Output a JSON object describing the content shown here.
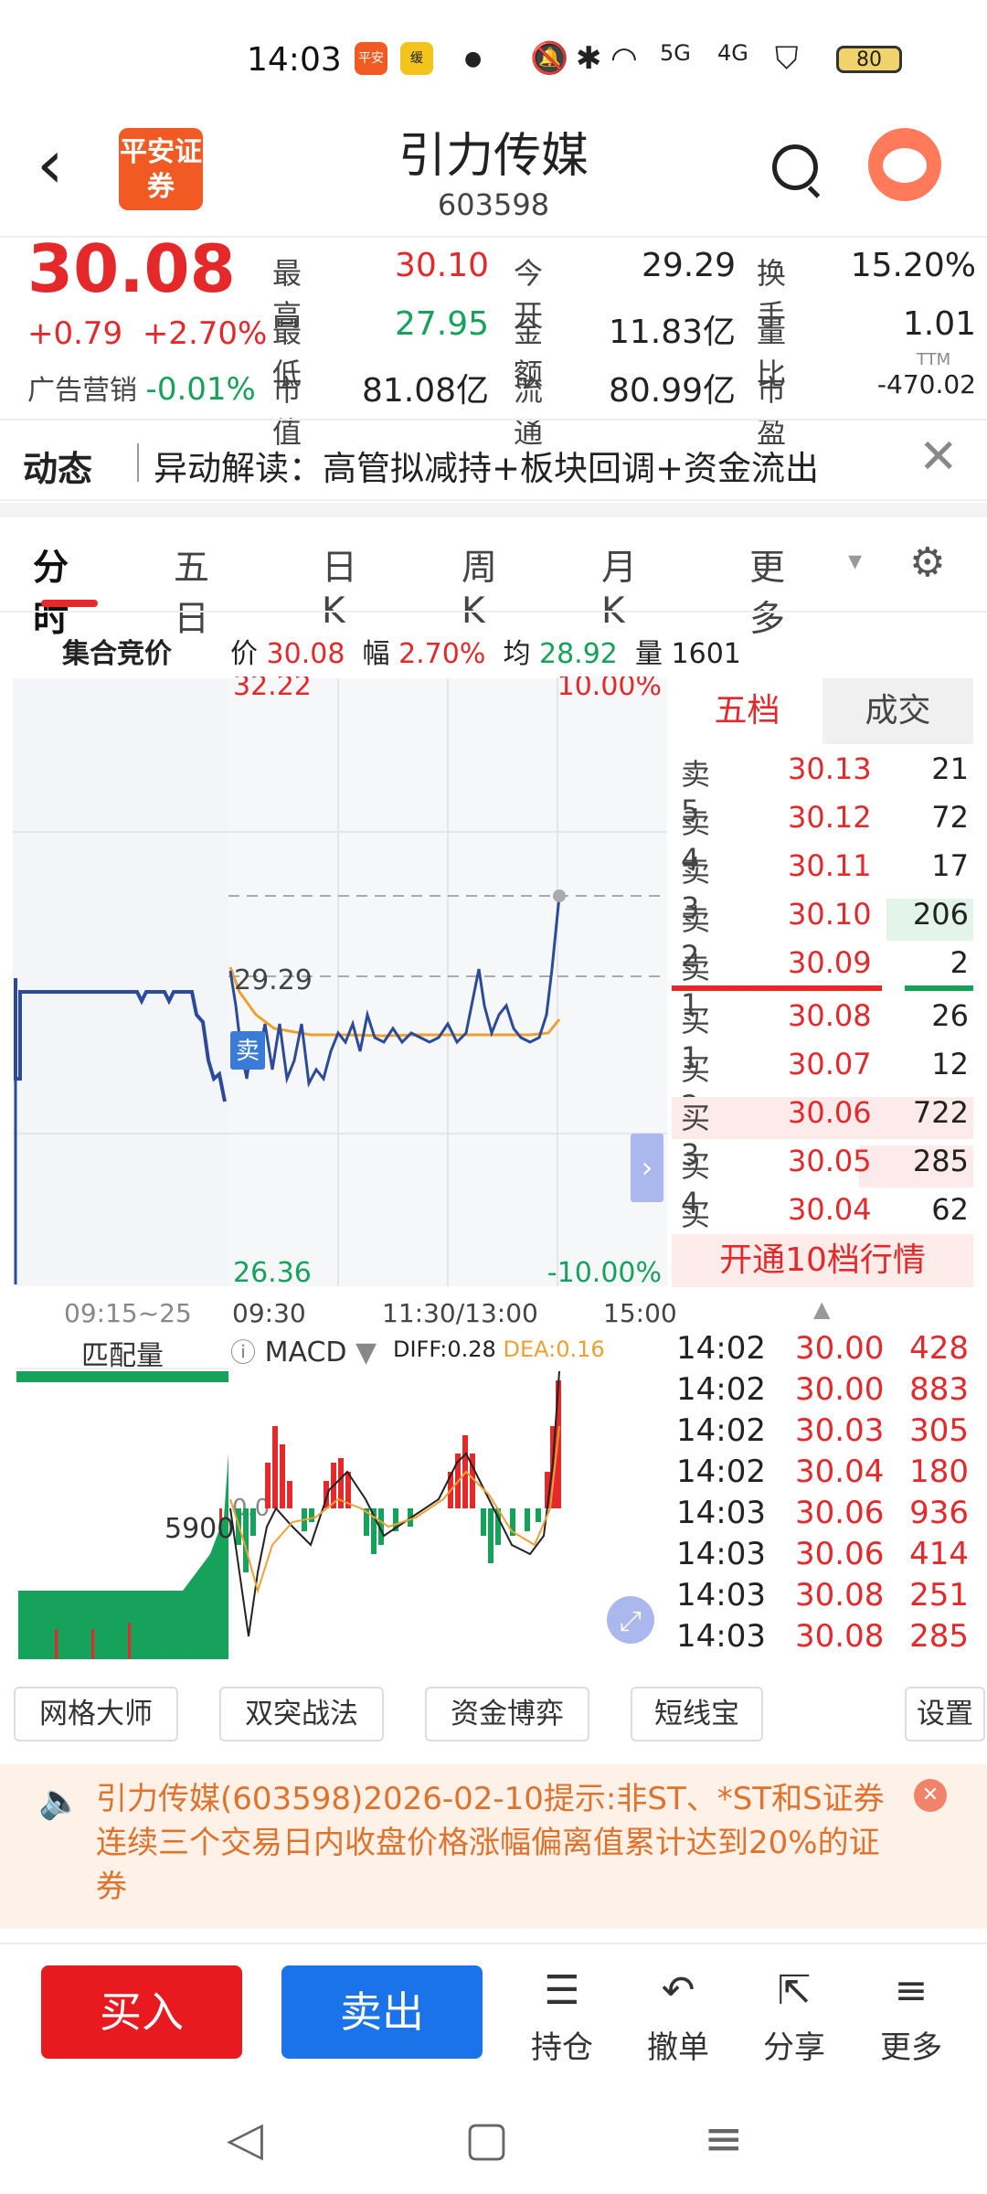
{
  "status": {
    "time": "14:03",
    "app1": "平安",
    "app2": "缓",
    "battery": "80",
    "signal1": "5G",
    "signal2": "4G"
  },
  "header": {
    "back": "‹",
    "logo": "平安证券",
    "title": "引力传媒",
    "code": "603598"
  },
  "quote": {
    "price": "30.08",
    "change": "+0.79",
    "change_pct": "+2.70%",
    "sector_label": "广告营销",
    "sector_value": "-0.01%",
    "cells": [
      {
        "label": "最高",
        "value": "30.10",
        "color": "red"
      },
      {
        "label": "今开",
        "value": "29.29",
        "color": "black"
      },
      {
        "label": "换手",
        "value": "15.20%",
        "color": "black"
      },
      {
        "label": "最低",
        "value": "27.95",
        "color": "green"
      },
      {
        "label": "金额",
        "value": "11.83亿",
        "color": "black"
      },
      {
        "label": "量比",
        "value": "1.01",
        "color": "black"
      },
      {
        "label": "市值",
        "value": "81.08亿",
        "color": "black"
      },
      {
        "label": "流通",
        "value": "80.99亿",
        "color": "black"
      },
      {
        "label": "市盈",
        "value": "-470.02",
        "color": "black"
      }
    ],
    "pe_sup": "TTM"
  },
  "news": {
    "tag": "动态",
    "text": "异动解读：高管拟减持+板块回调+资金流出",
    "close": "✕"
  },
  "tabs": [
    "分时",
    "五日",
    "日K",
    "周K",
    "月K",
    "更多"
  ],
  "tabs_more_arrow": "▾",
  "gear": "⚙",
  "minute": {
    "title": "集合竞价",
    "price_label": "价",
    "price": "30.08",
    "amp_label": "幅",
    "amp": "2.70%",
    "avg_label": "均",
    "avg": "28.92",
    "vol_label": "量",
    "vol": "1601",
    "y_top": "32.22",
    "y_bottom": "26.36",
    "pct_top": "10.00%",
    "pct_bottom": "-10.00%",
    "open_label": "29.29",
    "sell_marker": "卖",
    "x_labels": [
      "09:15~25",
      "09:30",
      "11:30/13:00",
      "15:00"
    ]
  },
  "book": {
    "tabs": [
      "五档",
      "成交"
    ],
    "asks": [
      {
        "label": "卖5",
        "price": "30.13",
        "vol": "21"
      },
      {
        "label": "卖4",
        "price": "30.12",
        "vol": "72"
      },
      {
        "label": "卖3",
        "price": "30.11",
        "vol": "17"
      },
      {
        "label": "卖2",
        "price": "30.10",
        "vol": "206"
      },
      {
        "label": "卖1",
        "price": "30.09",
        "vol": "2"
      }
    ],
    "bids": [
      {
        "label": "买1",
        "price": "30.08",
        "vol": "26"
      },
      {
        "label": "买2",
        "price": "30.07",
        "vol": "12"
      },
      {
        "label": "买3",
        "price": "30.06",
        "vol": "722"
      },
      {
        "label": "买4",
        "price": "30.05",
        "vol": "285"
      },
      {
        "label": "买5",
        "price": "30.04",
        "vol": "62"
      }
    ],
    "open10": "开通10档行情"
  },
  "ticks": [
    {
      "time": "14:02",
      "price": "30.00",
      "vol": "428"
    },
    {
      "time": "14:02",
      "price": "30.00",
      "vol": "883"
    },
    {
      "time": "14:02",
      "price": "30.03",
      "vol": "305"
    },
    {
      "time": "14:02",
      "price": "30.04",
      "vol": "180"
    },
    {
      "time": "14:03",
      "price": "30.06",
      "vol": "936"
    },
    {
      "time": "14:03",
      "price": "30.06",
      "vol": "414"
    },
    {
      "time": "14:03",
      "price": "30.08",
      "vol": "251"
    },
    {
      "time": "14:03",
      "price": "30.08",
      "vol": "285"
    }
  ],
  "macd": {
    "left_label": "匹配量",
    "indicator": "MACD",
    "diff": "DIFF:0.28",
    "dea": "DEA:0.16",
    "zero": "0.0",
    "match_level": "5900"
  },
  "tools": [
    "网格大师",
    "双突战法",
    "资金博弈",
    "短线宝",
    "设置"
  ],
  "notice": {
    "text": "引力传媒(603598)2026-02-10提示:非ST、*ST和S证券连续三个交易日内收盘价格涨幅偏离值累计达到20%的证券",
    "close": "✕",
    "icon": "🔈"
  },
  "footer": {
    "buy": "买入",
    "sell": "卖出",
    "items": [
      {
        "icon": "☰",
        "label": "持仓"
      },
      {
        "icon": "↶",
        "label": "撤单"
      },
      {
        "icon": "⇱",
        "label": "分享"
      },
      {
        "icon": "≡",
        "label": "更多"
      }
    ]
  },
  "nav": {
    "back": "◁",
    "home": "▢",
    "menu": "≡"
  },
  "colors": {
    "red": "#e5292b",
    "green": "#16a25a",
    "blue": "#1a73e8",
    "line": "#2c4a9a",
    "avg": "#f0a030"
  }
}
